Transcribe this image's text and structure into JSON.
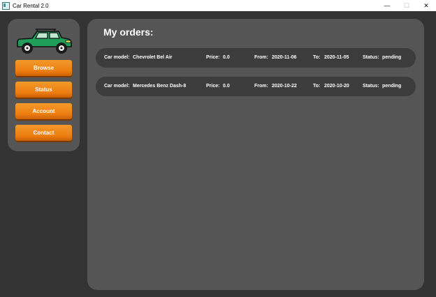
{
  "window": {
    "title": "Car Rental 2.0",
    "controls": {
      "minimize": "—",
      "maximize": "☐",
      "close": "✕"
    }
  },
  "sidebar": {
    "logo": "car-icon",
    "buttons": [
      "Browse",
      "Status",
      "Account",
      "Contact"
    ]
  },
  "main": {
    "heading": "My orders:",
    "labels": {
      "model": "Car model:",
      "price": "Price:",
      "from": "From:",
      "to": "To:",
      "status": "Status:"
    },
    "orders": [
      {
        "model": "Chevrolet Bel Air",
        "price": "0.0",
        "from": "2020-11-06",
        "to": "2020-11-05",
        "status": "pending"
      },
      {
        "model": "Mercedes Benz Dash-8",
        "price": "0.0",
        "from": "2020-10-22",
        "to": "2020-10-20",
        "status": "pending"
      }
    ]
  },
  "colors": {
    "accent": "#ee7d10",
    "panel": "#555555",
    "background": "#333333",
    "row": "#3c3c3c",
    "car": "#1f9e5a"
  }
}
